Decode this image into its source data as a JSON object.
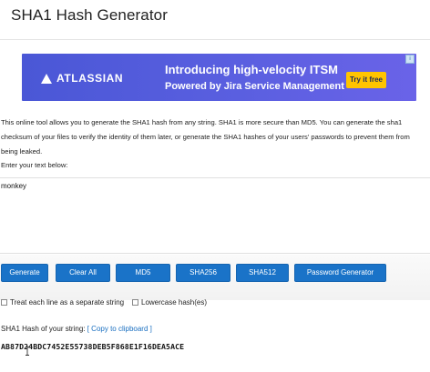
{
  "page": {
    "title": "SHA1 Hash Generator"
  },
  "ad": {
    "brand": "ATLASSIAN",
    "headline": "Introducing high-velocity ITSM",
    "subheadline": "Powered by Jira Service Management",
    "cta": "Try it free"
  },
  "description": "This online tool allows you to generate the SHA1 hash from any string. SHA1 is more secure than MD5. You can generate the sha1 checksum of your files to verify the identity of them later, or generate the SHA1 hashes of your users' passwords to prevent them from being leaked.",
  "input": {
    "prompt": "Enter your text below:",
    "value": "monkey"
  },
  "buttons": {
    "generate": "Generate",
    "clear_all": "Clear All",
    "md5": "MD5",
    "sha256": "SHA256",
    "sha512": "SHA512",
    "password_generator": "Password Generator"
  },
  "options": {
    "separate_lines": "Treat each line as a separate string",
    "lowercase": "Lowercase hash(es)"
  },
  "result": {
    "label": "SHA1 Hash of your string:",
    "copy_link": "[ Copy to clipboard ]",
    "hash": "AB87D24BDC7452E55738DEB5F868E1F16DEA5ACE"
  },
  "colors": {
    "button": "#1a73c8",
    "ad_bg": "#4a57d6",
    "ad_cta": "#ffc400",
    "link": "#1a6fc0"
  }
}
